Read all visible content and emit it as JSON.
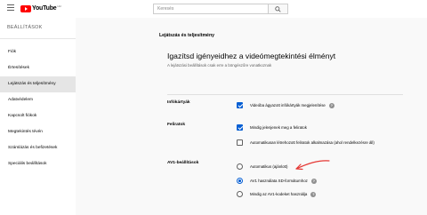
{
  "header": {
    "brand": "YouTube",
    "country": "HU",
    "search_placeholder": "Keresés"
  },
  "sidebar": {
    "title": "BEÁLLÍTÁSOK",
    "items": [
      {
        "label": "Fiók"
      },
      {
        "label": "Értesítések"
      },
      {
        "label": "Lejátszás és teljesítmény"
      },
      {
        "label": "Adatvédelem"
      },
      {
        "label": "Kapcsolt fiókok"
      },
      {
        "label": "Megtekintés tévén"
      },
      {
        "label": "Számlázás és befizetések"
      },
      {
        "label": "Speciális beállítások"
      }
    ],
    "active_index": 2
  },
  "main": {
    "section_title": "Lejátszás és teljesítmény",
    "headline": "Igazítsd igényeidhez a videómegtekintési élményt",
    "subtitle": "A lejátszási beállítások csak erre a böngészőre vonatkoznak",
    "infocards": {
      "label": "Infókártyák",
      "option": "Videóba ágyazott infókártyák megjelenítése",
      "checked": true
    },
    "captions": {
      "label": "Feliratok",
      "options": [
        {
          "label": "Mindig jelenjenek meg a feliratok",
          "checked": true
        },
        {
          "label": "Automatikusan létrehozott feliratok alkalmazása (ahol rendelkezésre áll)",
          "checked": false
        }
      ]
    },
    "av1": {
      "label": "AV1-beállítások",
      "options": [
        {
          "label": "Automatikus (ajánlott)",
          "selected": false
        },
        {
          "label": "AV1 használata SD-formátumhoz",
          "selected": true
        },
        {
          "label": "Mindig az AV1-kodeket használja",
          "selected": false
        }
      ]
    }
  },
  "colors": {
    "accent": "#065fd4",
    "brand_red": "#ff0000",
    "annotation": "#e53935"
  }
}
